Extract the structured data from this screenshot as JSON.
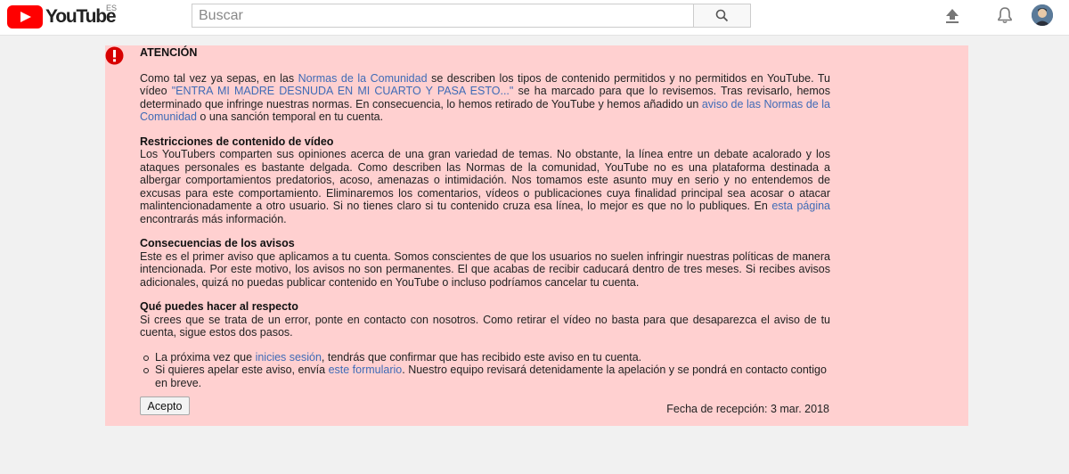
{
  "header": {
    "logo_text": "YouTube",
    "region": "ES",
    "search_placeholder": "Buscar",
    "icons": {
      "search": "search-icon",
      "upload": "upload-icon",
      "notifications": "bell-icon"
    },
    "colors": {
      "brand": "#ff0000"
    }
  },
  "alert": {
    "title": "ATENCIÓN",
    "intro": {
      "t1": "Como tal vez ya sepas, en las ",
      "link1": "Normas de la Comunidad",
      "t2": " se describen los tipos de contenido permitidos y no permitidos en YouTube. Tu vídeo ",
      "video_title": "\"ENTRA MI MADRE DESNUDA EN MI CUARTO Y PASA ESTO...\"",
      "t3": " se ha marcado para que lo revisemos. Tras revisarlo, hemos determinado que infringe nuestras normas. En consecuencia, lo hemos retirado de YouTube y hemos añadido un ",
      "link2": "aviso de las Normas de la Comunidad",
      "t4": " o una sanción temporal en tu cuenta."
    },
    "restrictions": {
      "heading": "Restricciones de contenido de vídeo",
      "text": "Los YouTubers comparten sus opiniones acerca de una gran variedad de temas. No obstante, la línea entre un debate acalorado y los ataques personales es bastante delgada. Como describen las Normas de la comunidad, YouTube no es una plataforma destinada a albergar comportamientos predatorios, acoso, amenazas o intimidación. Nos tomamos este asunto muy en serio y no entendemos de excusas para este comportamiento. Eliminaremos los comentarios, vídeos o publicaciones cuya finalidad principal sea acosar o atacar malintencionadamente a otro usuario. Si no tienes claro si tu contenido cruza esa línea, lo mejor es que no lo publiques. En ",
      "link": "esta página",
      "text_end": " encontrarás más información."
    },
    "consequences": {
      "heading": "Consecuencias de los avisos",
      "text": "Este es el primer aviso que aplicamos a tu cuenta. Somos conscientes de que los usuarios no suelen infringir nuestras políticas de manera intencionada. Por este motivo, los avisos no son permanentes. El que acabas de recibir caducará dentro de tres meses. Si recibes avisos adicionales, quizá no puedas publicar contenido en YouTube o incluso podríamos cancelar tu cuenta."
    },
    "actions": {
      "heading": "Qué puedes hacer al respecto",
      "text": "Si crees que se trata de un error, ponte en contacto con nosotros. Como retirar el vídeo no basta para que desaparezca el aviso de tu cuenta, sigue estos dos pasos.",
      "step1_a": "La próxima vez que ",
      "step1_link": "inicies sesión",
      "step1_b": ", tendrás que confirmar que has recibido este aviso en tu cuenta.",
      "step2_a": "Si quieres apelar este aviso, envía ",
      "step2_link": "este formulario",
      "step2_b": ". Nuestro equipo revisará detenidamente la apelación y se pondrá en contacto contigo en breve."
    },
    "accept_label": "Acepto",
    "received": "Fecha de recepción: 3 mar. 2018",
    "colors": {
      "background": "#ffd0d0",
      "icon": "#d70000",
      "link": "#3f6bb6"
    }
  }
}
